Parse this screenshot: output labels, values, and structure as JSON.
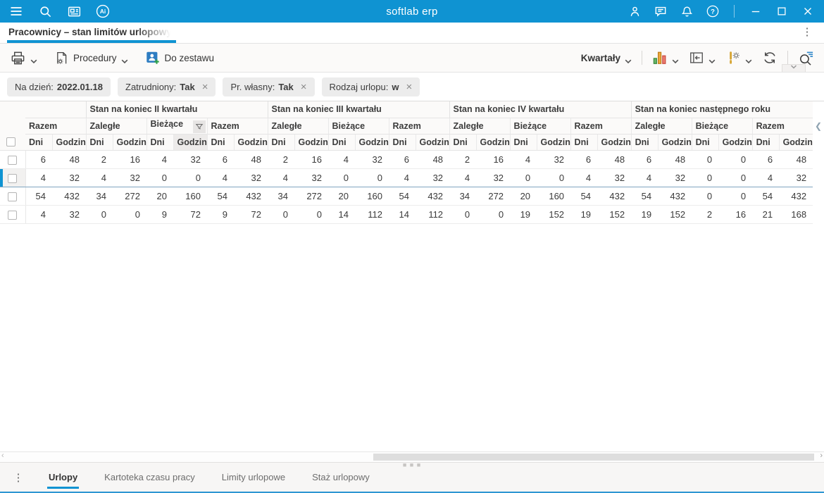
{
  "colors": {
    "topbar": "#0f93d2",
    "accent": "#0f93d2",
    "toolbar_bg": "#fbfaf9",
    "chip_bg": "#ececec",
    "bottom_bg": "#f7f6f5",
    "sel_border": "#7fa5c0",
    "bar_green": "#69b86a",
    "bar_orange": "#f0a93c",
    "bar_red": "#ef7d72"
  },
  "topbar": {
    "title": "softlab erp",
    "left": [
      {
        "icon": "menu-icon",
        "name": "menu-button"
      },
      {
        "icon": "search-icon",
        "name": "search-button"
      },
      {
        "icon": "news-icon",
        "name": "news-button"
      },
      {
        "icon": "ai-icon",
        "name": "ai-assistant-button"
      }
    ],
    "right": [
      {
        "icon": "user-icon",
        "name": "user-account-button"
      },
      {
        "icon": "chat-icon",
        "name": "messages-button"
      },
      {
        "icon": "bell-icon",
        "name": "notifications-button"
      },
      {
        "icon": "help-icon",
        "name": "help-button"
      }
    ],
    "window": [
      {
        "icon": "minimize-icon",
        "name": "minimize-button"
      },
      {
        "icon": "maximize-icon",
        "name": "maximize-button"
      },
      {
        "icon": "close-icon",
        "name": "close-button"
      }
    ]
  },
  "tabbar": {
    "tab": "Pracownicy – stan limitów urlopowych"
  },
  "toolbar": {
    "left": [
      {
        "icon": "printer-icon",
        "label": "",
        "chevron": true,
        "name": "print-button"
      },
      {
        "icon": "procedures-icon",
        "label": "Procedury",
        "chevron": true,
        "name": "procedures-button"
      },
      {
        "icon": "add-person-icon",
        "label": "Do zestawu",
        "chevron": false,
        "name": "add-to-set-button"
      }
    ],
    "right": [
      {
        "type": "button",
        "label": "Kwartały",
        "chevron": true,
        "bold": true,
        "name": "quarters-dropdown"
      },
      {
        "type": "sep"
      },
      {
        "type": "icon",
        "icon": "chart-bars-icon",
        "chevron": true,
        "name": "chart-view-button"
      },
      {
        "type": "icon",
        "icon": "panel-left-icon",
        "chevron": true,
        "name": "panel-layout-button"
      },
      {
        "type": "icon",
        "icon": "alert-settings-icon",
        "chevron": true,
        "name": "alerts-settings-button"
      },
      {
        "type": "icon",
        "icon": "refresh-icon",
        "chevron": false,
        "name": "refresh-button"
      },
      {
        "type": "sep"
      },
      {
        "type": "icon",
        "icon": "search-filter-icon",
        "chevron": false,
        "name": "search-in-grid-button"
      }
    ]
  },
  "filters": [
    {
      "label": "Na dzień:",
      "value": "2022.01.18",
      "closable": false
    },
    {
      "label": "Zatrudniony:",
      "value": "Tak",
      "closable": true
    },
    {
      "label": "Pr. własny:",
      "value": "Tak",
      "closable": true
    },
    {
      "label": "Rodzaj urlopu:",
      "value": "w",
      "closable": true
    }
  ],
  "table": {
    "groups": [
      {
        "label": "",
        "subs": [
          {
            "label": "Razem"
          }
        ]
      },
      {
        "label": "Stan na koniec II kwartału",
        "subs": [
          {
            "label": "Zaległe"
          },
          {
            "label": "Bieżące",
            "filtered": true
          },
          {
            "label": "Razem"
          }
        ]
      },
      {
        "label": "Stan na koniec III kwartału",
        "subs": [
          {
            "label": "Zaległe"
          },
          {
            "label": "Bieżące"
          },
          {
            "label": "Razem"
          }
        ]
      },
      {
        "label": "Stan na koniec IV kwartału",
        "subs": [
          {
            "label": "Zaległe"
          },
          {
            "label": "Bieżące"
          },
          {
            "label": "Razem"
          }
        ]
      },
      {
        "label": "Stan na koniec następnego roku",
        "subs": [
          {
            "label": "Zaległe"
          },
          {
            "label": "Bieżące"
          },
          {
            "label": "Razem"
          }
        ]
      }
    ],
    "units": [
      "Dni",
      "Godziny"
    ],
    "rows": [
      {
        "selected": false,
        "values": [
          6,
          48,
          2,
          16,
          4,
          32,
          6,
          48,
          2,
          16,
          4,
          32,
          6,
          48,
          2,
          16,
          4,
          32,
          6,
          48,
          6,
          48,
          0,
          0,
          6,
          48
        ]
      },
      {
        "selected": true,
        "values": [
          4,
          32,
          4,
          32,
          0,
          0,
          4,
          32,
          4,
          32,
          0,
          0,
          4,
          32,
          4,
          32,
          0,
          0,
          4,
          32,
          4,
          32,
          0,
          0,
          4,
          32
        ]
      },
      {
        "selected": false,
        "values": [
          54,
          432,
          34,
          272,
          20,
          160,
          54,
          432,
          34,
          272,
          20,
          160,
          54,
          432,
          34,
          272,
          20,
          160,
          54,
          432,
          54,
          432,
          0,
          0,
          54,
          432
        ]
      },
      {
        "selected": false,
        "values": [
          4,
          32,
          0,
          0,
          9,
          72,
          9,
          72,
          0,
          0,
          14,
          112,
          14,
          112,
          0,
          0,
          19,
          152,
          19,
          152,
          19,
          152,
          2,
          16,
          21,
          168
        ]
      }
    ]
  },
  "scrollbar": {
    "left_arrow": "‹",
    "right_arrow": "›"
  },
  "bottom_tabs": [
    {
      "label": "Urlopy",
      "active": true
    },
    {
      "label": "Kartoteka czasu pracy",
      "active": false
    },
    {
      "label": "Limity urlopowe",
      "active": false
    },
    {
      "label": "Staż urlopowy",
      "active": false
    }
  ]
}
